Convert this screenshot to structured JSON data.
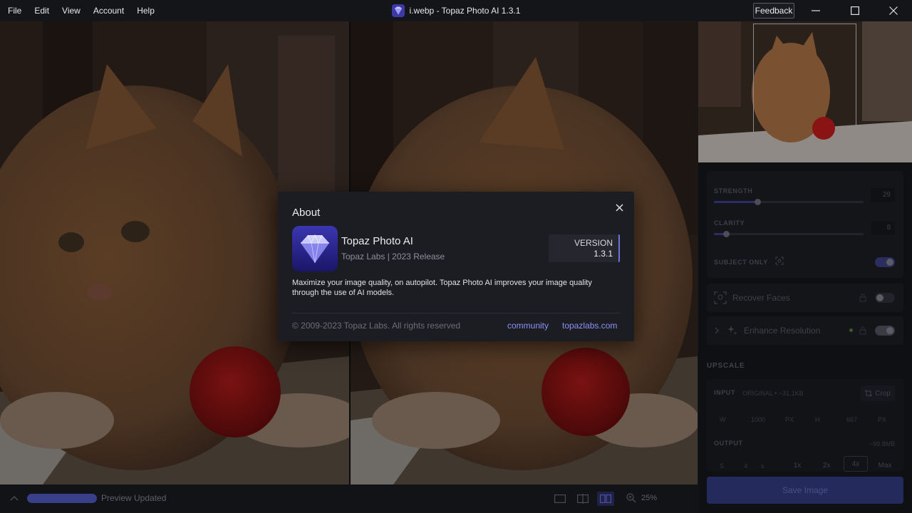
{
  "menu": [
    "File",
    "Edit",
    "View",
    "Account",
    "Help"
  ],
  "window": {
    "title": "i.webp - Topaz Photo AI 1.3.1",
    "feedback_label": "Feedback"
  },
  "bottom_bar": {
    "status": "Preview Updated",
    "zoom": "25%"
  },
  "right_panel": {
    "strength_label": "STRENGTH",
    "strength_value": "29",
    "strength_fraction": 0.29,
    "clarity_label": "CLARITY",
    "clarity_value": "8",
    "clarity_fraction": 0.08,
    "subject_only_label": "SUBJECT ONLY",
    "subject_only_on": true,
    "recover_faces_label": "Recover Faces",
    "recover_faces_on": false,
    "enhance_resolution_label": "Enhance Resolution",
    "enhance_resolution_on": true,
    "upscale_title": "UPSCALE",
    "input_label": "INPUT",
    "input_info": "ORIGINAL • ~31.1KB",
    "crop_label": "Crop",
    "input_row": [
      "W",
      "1000",
      "PX",
      "H",
      "667",
      "PX"
    ],
    "output_label": "OUTPUT",
    "output_size": "~99.8MB",
    "output_row": [
      "S",
      "4",
      "x"
    ],
    "scale_options": [
      "1x",
      "2x",
      "4x",
      "Max"
    ],
    "save_label": "Save Image"
  },
  "about": {
    "title": "About",
    "app_name": "Topaz Photo AI",
    "subtitle": "Topaz Labs | 2023 Release",
    "version_label": "VERSION",
    "version": "1.3.1",
    "description": "Maximize your image quality, on autopilot. Topaz Photo AI improves your image quality through the use of AI models.",
    "copyright": "© 2009-2023 Topaz Labs. All rights reserved",
    "link_community": "community",
    "link_site": "topazlabs.com"
  },
  "colors": {
    "accent": "#6f74d8",
    "link": "#8c92f4",
    "dialog_bg": "#1c1d23"
  }
}
